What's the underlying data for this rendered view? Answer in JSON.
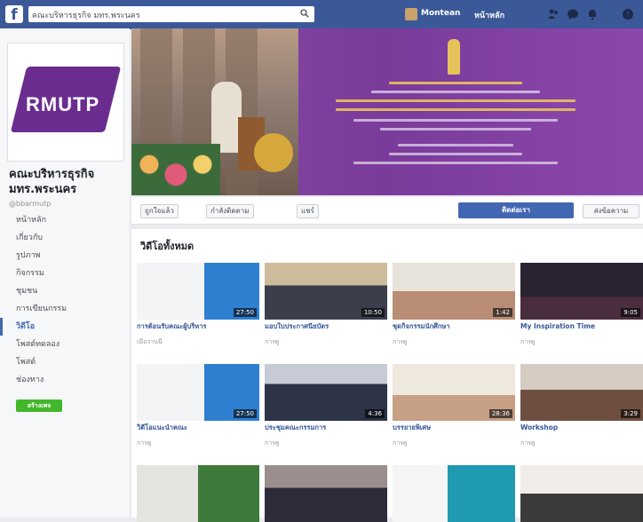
{
  "topbar": {
    "search_value": "คณะบริหารธุรกิจ มทร.พระนคร",
    "profile_name": "Montean",
    "home_label": "หน้าหลัก"
  },
  "page": {
    "logo_text": "RMUTP",
    "name": "คณะบริหารธุรกิจ มทร.พระนคร",
    "handle": "@bbarmutp"
  },
  "sidebar": {
    "items": [
      {
        "label": "หน้าหลัก"
      },
      {
        "label": "เกี่ยวกับ"
      },
      {
        "label": "รูปภาพ"
      },
      {
        "label": "กิจกรรม"
      },
      {
        "label": "ชุมชน"
      },
      {
        "label": "การเขียนกรรม"
      },
      {
        "label": "วิดีโอ"
      },
      {
        "label": "โพสต์ทดลอง"
      },
      {
        "label": "โพสต์"
      },
      {
        "label": "ช่องทาง"
      }
    ],
    "create_label": "สร้างเพจ"
  },
  "action_bar": {
    "like_label": "ถูกใจแล้ว",
    "follow_label": "กำลังติดตาม",
    "share_label": "แชร์",
    "primary_label": "ติดต่อเรา",
    "message_label": "ส่งข้อความ"
  },
  "videos_section": {
    "title": "วิดีโอทั้งหมด"
  },
  "videos": [
    {
      "title": "การต้อนรับคณะผู้บริหาร",
      "meta": "เมื่อวานนี้",
      "duration": "27:50",
      "theme": "blue"
    },
    {
      "title": "มอบใบประกาศนียบัตร",
      "meta": "การดู",
      "duration": "10:50",
      "theme": "ceremony"
    },
    {
      "title": "ชุดกิจกรรมนักศึกษา",
      "meta": "การดู",
      "duration": "1:42",
      "theme": "bright"
    },
    {
      "title": "My Inspiration Time",
      "meta": "การดู",
      "duration": "9:05",
      "theme": "dark"
    },
    {
      "title": "วิดีโอแนะนำคณะ",
      "meta": "การดู",
      "duration": "27:50",
      "theme": "blue"
    },
    {
      "title": "ประชุมคณะกรรมการ",
      "meta": "การดู",
      "duration": "4:36",
      "theme": "meeting"
    },
    {
      "title": "บรรยายพิเศษ",
      "meta": "การดู",
      "duration": "28:36",
      "theme": "bright2"
    },
    {
      "title": "Workshop",
      "meta": "การดู",
      "duration": "3:29",
      "theme": "lecture"
    },
    {
      "title": "",
      "meta": "",
      "duration": "",
      "theme": "talk"
    },
    {
      "title": "",
      "meta": "",
      "duration": "",
      "theme": "group"
    },
    {
      "title": "",
      "meta": "",
      "duration": "",
      "theme": "poster"
    },
    {
      "title": "",
      "meta": "",
      "duration": "",
      "theme": "couple"
    }
  ]
}
